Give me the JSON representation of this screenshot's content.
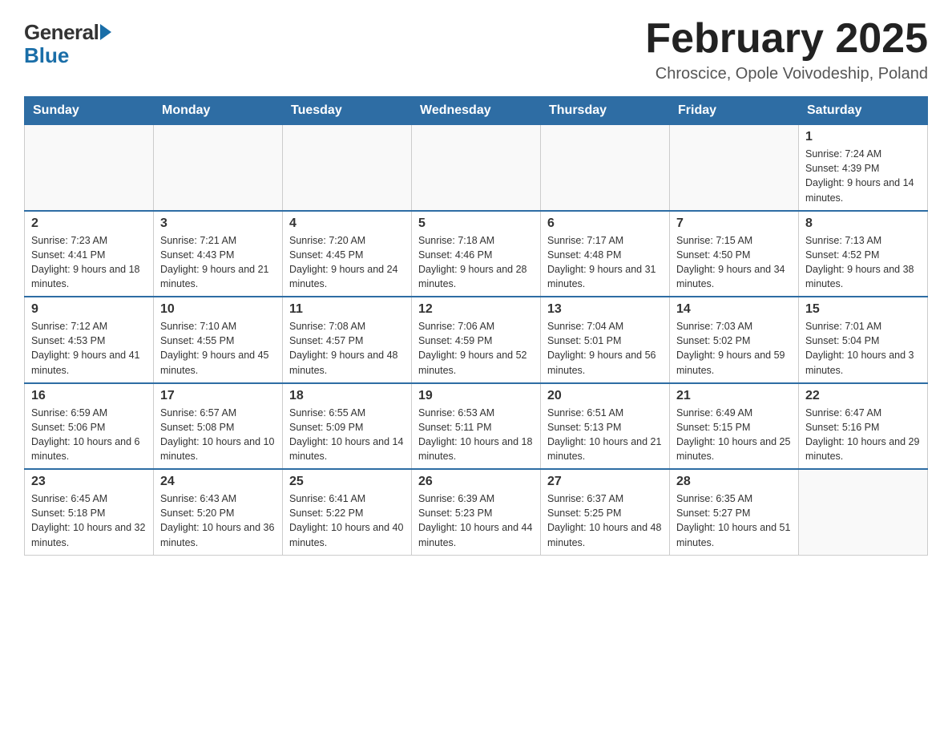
{
  "logo": {
    "general": "General",
    "blue": "Blue"
  },
  "title": "February 2025",
  "location": "Chroscice, Opole Voivodeship, Poland",
  "weekdays": [
    "Sunday",
    "Monday",
    "Tuesday",
    "Wednesday",
    "Thursday",
    "Friday",
    "Saturday"
  ],
  "weeks": [
    [
      {
        "day": "",
        "info": ""
      },
      {
        "day": "",
        "info": ""
      },
      {
        "day": "",
        "info": ""
      },
      {
        "day": "",
        "info": ""
      },
      {
        "day": "",
        "info": ""
      },
      {
        "day": "",
        "info": ""
      },
      {
        "day": "1",
        "info": "Sunrise: 7:24 AM\nSunset: 4:39 PM\nDaylight: 9 hours and 14 minutes."
      }
    ],
    [
      {
        "day": "2",
        "info": "Sunrise: 7:23 AM\nSunset: 4:41 PM\nDaylight: 9 hours and 18 minutes."
      },
      {
        "day": "3",
        "info": "Sunrise: 7:21 AM\nSunset: 4:43 PM\nDaylight: 9 hours and 21 minutes."
      },
      {
        "day": "4",
        "info": "Sunrise: 7:20 AM\nSunset: 4:45 PM\nDaylight: 9 hours and 24 minutes."
      },
      {
        "day": "5",
        "info": "Sunrise: 7:18 AM\nSunset: 4:46 PM\nDaylight: 9 hours and 28 minutes."
      },
      {
        "day": "6",
        "info": "Sunrise: 7:17 AM\nSunset: 4:48 PM\nDaylight: 9 hours and 31 minutes."
      },
      {
        "day": "7",
        "info": "Sunrise: 7:15 AM\nSunset: 4:50 PM\nDaylight: 9 hours and 34 minutes."
      },
      {
        "day": "8",
        "info": "Sunrise: 7:13 AM\nSunset: 4:52 PM\nDaylight: 9 hours and 38 minutes."
      }
    ],
    [
      {
        "day": "9",
        "info": "Sunrise: 7:12 AM\nSunset: 4:53 PM\nDaylight: 9 hours and 41 minutes."
      },
      {
        "day": "10",
        "info": "Sunrise: 7:10 AM\nSunset: 4:55 PM\nDaylight: 9 hours and 45 minutes."
      },
      {
        "day": "11",
        "info": "Sunrise: 7:08 AM\nSunset: 4:57 PM\nDaylight: 9 hours and 48 minutes."
      },
      {
        "day": "12",
        "info": "Sunrise: 7:06 AM\nSunset: 4:59 PM\nDaylight: 9 hours and 52 minutes."
      },
      {
        "day": "13",
        "info": "Sunrise: 7:04 AM\nSunset: 5:01 PM\nDaylight: 9 hours and 56 minutes."
      },
      {
        "day": "14",
        "info": "Sunrise: 7:03 AM\nSunset: 5:02 PM\nDaylight: 9 hours and 59 minutes."
      },
      {
        "day": "15",
        "info": "Sunrise: 7:01 AM\nSunset: 5:04 PM\nDaylight: 10 hours and 3 minutes."
      }
    ],
    [
      {
        "day": "16",
        "info": "Sunrise: 6:59 AM\nSunset: 5:06 PM\nDaylight: 10 hours and 6 minutes."
      },
      {
        "day": "17",
        "info": "Sunrise: 6:57 AM\nSunset: 5:08 PM\nDaylight: 10 hours and 10 minutes."
      },
      {
        "day": "18",
        "info": "Sunrise: 6:55 AM\nSunset: 5:09 PM\nDaylight: 10 hours and 14 minutes."
      },
      {
        "day": "19",
        "info": "Sunrise: 6:53 AM\nSunset: 5:11 PM\nDaylight: 10 hours and 18 minutes."
      },
      {
        "day": "20",
        "info": "Sunrise: 6:51 AM\nSunset: 5:13 PM\nDaylight: 10 hours and 21 minutes."
      },
      {
        "day": "21",
        "info": "Sunrise: 6:49 AM\nSunset: 5:15 PM\nDaylight: 10 hours and 25 minutes."
      },
      {
        "day": "22",
        "info": "Sunrise: 6:47 AM\nSunset: 5:16 PM\nDaylight: 10 hours and 29 minutes."
      }
    ],
    [
      {
        "day": "23",
        "info": "Sunrise: 6:45 AM\nSunset: 5:18 PM\nDaylight: 10 hours and 32 minutes."
      },
      {
        "day": "24",
        "info": "Sunrise: 6:43 AM\nSunset: 5:20 PM\nDaylight: 10 hours and 36 minutes."
      },
      {
        "day": "25",
        "info": "Sunrise: 6:41 AM\nSunset: 5:22 PM\nDaylight: 10 hours and 40 minutes."
      },
      {
        "day": "26",
        "info": "Sunrise: 6:39 AM\nSunset: 5:23 PM\nDaylight: 10 hours and 44 minutes."
      },
      {
        "day": "27",
        "info": "Sunrise: 6:37 AM\nSunset: 5:25 PM\nDaylight: 10 hours and 48 minutes."
      },
      {
        "day": "28",
        "info": "Sunrise: 6:35 AM\nSunset: 5:27 PM\nDaylight: 10 hours and 51 minutes."
      },
      {
        "day": "",
        "info": ""
      }
    ]
  ]
}
